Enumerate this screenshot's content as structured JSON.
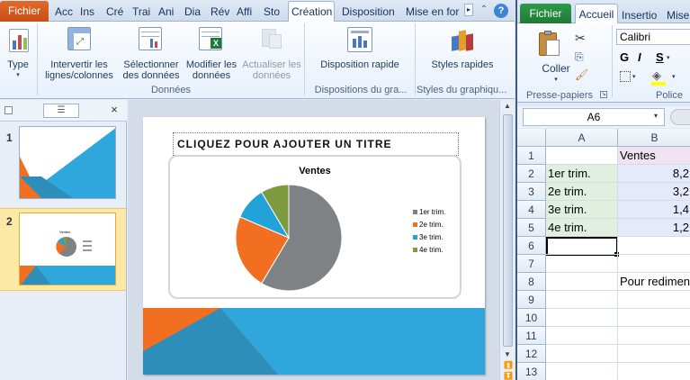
{
  "ppt": {
    "tabs": [
      "Fichier",
      "Acc",
      "Ins",
      "Cré",
      "Trai",
      "Ani",
      "Dia",
      "Rév",
      "Affi",
      "Sto",
      "Création",
      "Disposition",
      "Mise en for"
    ],
    "ribbon": {
      "type_label": "Type",
      "switch_label": "Intervertir les lignes/colonnes",
      "select_label": "Sélectionner des données",
      "edit_label": "Modifier les données",
      "refresh_label": "Actualiser les données",
      "group_data": "Données",
      "layout_label": "Disposition rapide",
      "group_layouts": "Dispositions du gra...",
      "styles_label": "Styles rapides",
      "group_styles": "Styles du graphiqu..."
    },
    "slides": [
      "1",
      "2"
    ],
    "slide": {
      "title_placeholder": "CLIQUEZ POUR AJOUTER UN TITRE",
      "chart_title": "Ventes"
    }
  },
  "chart_data": {
    "type": "pie",
    "title": "Ventes",
    "categories": [
      "1er trim.",
      "2e trim.",
      "3e trim.",
      "4e trim."
    ],
    "values": [
      8.2,
      3.2,
      1.4,
      1.2
    ],
    "colors": [
      "#7f8285",
      "#f26f21",
      "#21a3d9",
      "#7e9a3f"
    ],
    "legend": "right"
  },
  "excel": {
    "tabs": [
      "Fichier",
      "Accueil",
      "Insertio",
      "Mise"
    ],
    "ribbon": {
      "paste_label": "Coller",
      "font_name": "Calibri",
      "bold": "G",
      "italic": "I",
      "underline": "S",
      "group_clipboard": "Presse-papiers",
      "group_font": "Police"
    },
    "name_box": "A6",
    "columns": [
      "A",
      "B"
    ],
    "rows": [
      {
        "n": "1",
        "a": "",
        "b": "Ventes"
      },
      {
        "n": "2",
        "a": "1er trim.",
        "b": "8,2"
      },
      {
        "n": "3",
        "a": "2e trim.",
        "b": "3,2"
      },
      {
        "n": "4",
        "a": "3e trim.",
        "b": "1,4"
      },
      {
        "n": "5",
        "a": "4e trim.",
        "b": "1,2"
      },
      {
        "n": "6",
        "a": "",
        "b": ""
      },
      {
        "n": "7",
        "a": "",
        "b": ""
      },
      {
        "n": "8",
        "a": "",
        "b": "Pour redimen"
      },
      {
        "n": "9",
        "a": "",
        "b": ""
      },
      {
        "n": "10",
        "a": "",
        "b": ""
      },
      {
        "n": "11",
        "a": "",
        "b": ""
      },
      {
        "n": "12",
        "a": "",
        "b": ""
      },
      {
        "n": "13",
        "a": "",
        "b": ""
      }
    ]
  }
}
